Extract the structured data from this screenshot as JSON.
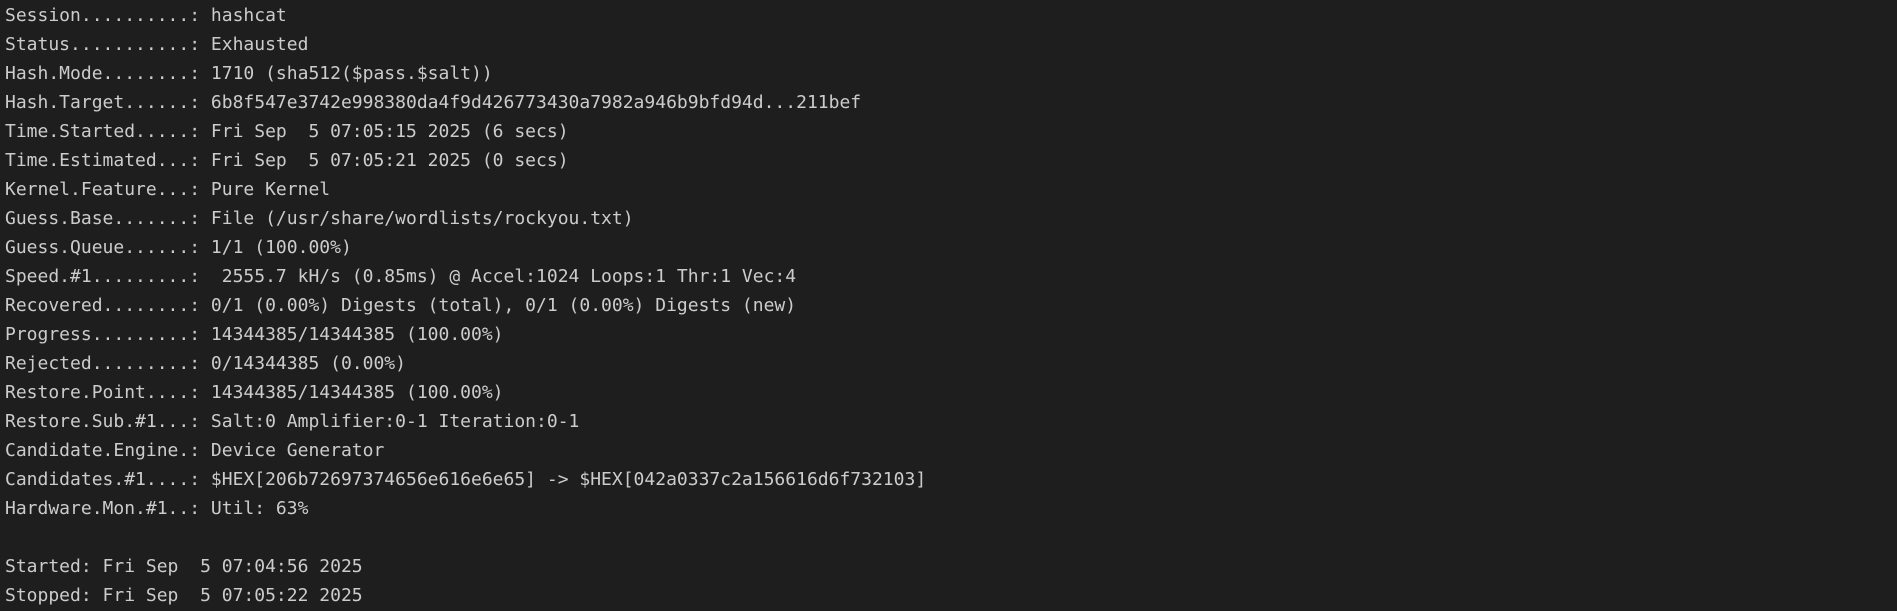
{
  "status_lines": [
    {
      "key": "Session..........:",
      "value": " hashcat"
    },
    {
      "key": "Status...........:",
      "value": " Exhausted"
    },
    {
      "key": "Hash.Mode........:",
      "value": " 1710 (sha512($pass.$salt))"
    },
    {
      "key": "Hash.Target......:",
      "value": " 6b8f547e3742e998380da4f9d426773430a7982a946b9bfd94d...211bef"
    },
    {
      "key": "Time.Started.....:",
      "value": " Fri Sep  5 07:05:15 2025 (6 secs)"
    },
    {
      "key": "Time.Estimated...:",
      "value": " Fri Sep  5 07:05:21 2025 (0 secs)"
    },
    {
      "key": "Kernel.Feature...:",
      "value": " Pure Kernel"
    },
    {
      "key": "Guess.Base.......:",
      "value": " File (/usr/share/wordlists/rockyou.txt)"
    },
    {
      "key": "Guess.Queue......:",
      "value": " 1/1 (100.00%)"
    },
    {
      "key": "Speed.#1.........:",
      "value": "  2555.7 kH/s (0.85ms) @ Accel:1024 Loops:1 Thr:1 Vec:4"
    },
    {
      "key": "Recovered........:",
      "value": " 0/1 (0.00%) Digests (total), 0/1 (0.00%) Digests (new)"
    },
    {
      "key": "Progress.........:",
      "value": " 14344385/14344385 (100.00%)"
    },
    {
      "key": "Rejected.........:",
      "value": " 0/14344385 (0.00%)"
    },
    {
      "key": "Restore.Point....:",
      "value": " 14344385/14344385 (100.00%)"
    },
    {
      "key": "Restore.Sub.#1...:",
      "value": " Salt:0 Amplifier:0-1 Iteration:0-1"
    },
    {
      "key": "Candidate.Engine.:",
      "value": " Device Generator"
    },
    {
      "key": "Candidates.#1....:",
      "value": " $HEX[206b72697374656e616e6e65] -> $HEX[042a0337c2a156616d6f732103]"
    },
    {
      "key": "Hardware.Mon.#1..:",
      "value": " Util: 63%"
    }
  ],
  "started": "Started: Fri Sep  5 07:04:56 2025",
  "stopped": "Stopped: Fri Sep  5 07:05:22 2025",
  "colors": {
    "background": "#1e1e1e",
    "text": "#cccccc"
  }
}
